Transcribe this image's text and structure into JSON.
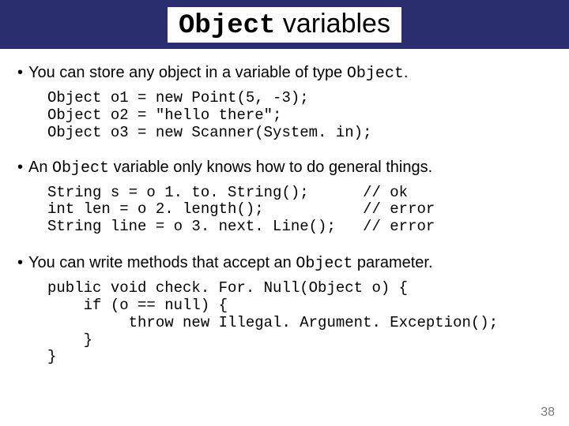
{
  "title": {
    "mono": "Object",
    "rest": " variables"
  },
  "bullets": {
    "b1_pre": "You can store any object in a variable of type ",
    "b1_mono": "Object",
    "b1_post": ".",
    "b2_pre": "An ",
    "b2_mono": "Object",
    "b2_post": " variable only knows how to do general things.",
    "b3_pre": "You can write methods that accept an ",
    "b3_mono": "Object",
    "b3_post": " parameter."
  },
  "code1": "Object o1 = new Point(5, -3);\nObject o2 = \"hello there\";\nObject o3 = new Scanner(System. in);",
  "code2": "String s = o 1. to. String();      // ok\nint len = o 2. length();           // error\nString line = o 3. next. Line();   // error",
  "code3": "public void check. For. Null(Object o) {\n    if (o == null) {\n         throw new Illegal. Argument. Exception();\n    }\n}",
  "page": "38"
}
